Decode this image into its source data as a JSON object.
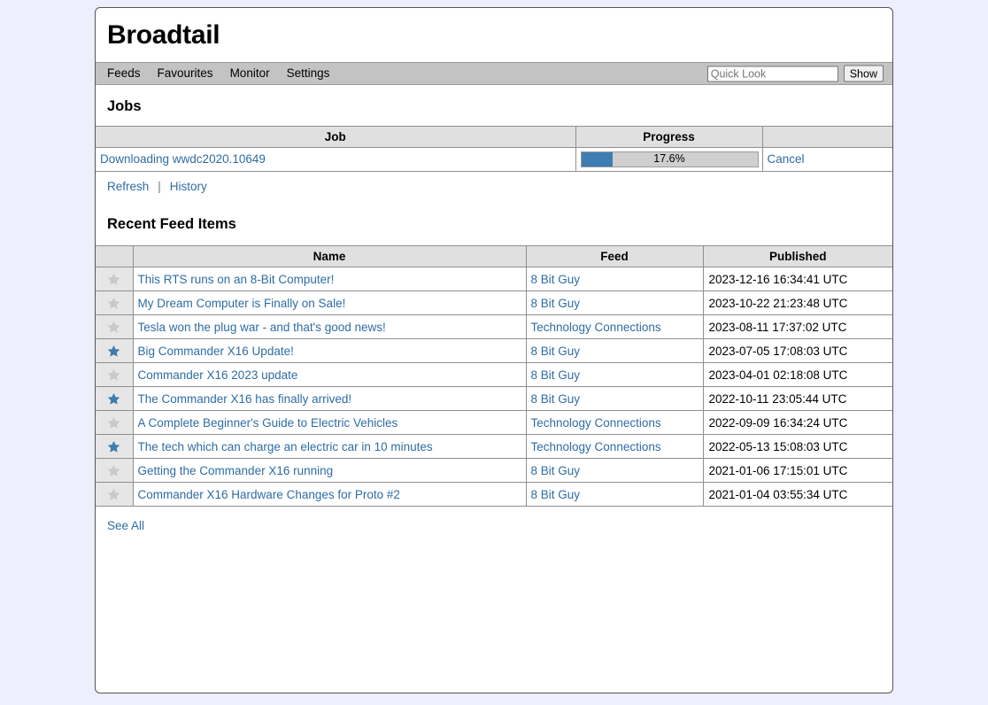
{
  "app": {
    "title": "Broadtail"
  },
  "nav": {
    "items": [
      {
        "label": "Feeds"
      },
      {
        "label": "Favourites"
      },
      {
        "label": "Monitor"
      },
      {
        "label": "Settings"
      }
    ],
    "quick_look": {
      "placeholder": "Quick Look",
      "value": "",
      "button_label": "Show"
    }
  },
  "jobs_section": {
    "heading": "Jobs",
    "columns": {
      "job": "Job",
      "progress": "Progress",
      "action": ""
    },
    "rows": [
      {
        "name": "Downloading wwdc2020.10649",
        "progress_percent": 17.6,
        "progress_label": "17.6%",
        "action_label": "Cancel"
      }
    ],
    "actions": {
      "refresh": "Refresh",
      "separator": "|",
      "history": "History"
    }
  },
  "feed_section": {
    "heading": "Recent Feed Items",
    "columns": {
      "star": "",
      "name": "Name",
      "feed": "Feed",
      "published": "Published"
    },
    "rows": [
      {
        "favourite": false,
        "star_icon": "star-outline-icon",
        "name": "This RTS runs on an 8-Bit Computer!",
        "feed": "8 Bit Guy",
        "published": "2023-12-16 16:34:41 UTC"
      },
      {
        "favourite": false,
        "star_icon": "star-outline-icon",
        "name": "My Dream Computer is Finally on Sale!",
        "feed": "8 Bit Guy",
        "published": "2023-10-22 21:23:48 UTC"
      },
      {
        "favourite": false,
        "star_icon": "star-outline-icon",
        "name": "Tesla won the plug war - and that's good news!",
        "feed": "Technology Connections",
        "published": "2023-08-11 17:37:02 UTC"
      },
      {
        "favourite": true,
        "star_icon": "star-filled-icon",
        "name": "Big Commander X16 Update!",
        "feed": "8 Bit Guy",
        "published": "2023-07-05 17:08:03 UTC"
      },
      {
        "favourite": false,
        "star_icon": "star-outline-icon",
        "name": "Commander X16 2023 update",
        "feed": "8 Bit Guy",
        "published": "2023-04-01 02:18:08 UTC"
      },
      {
        "favourite": true,
        "star_icon": "star-filled-icon",
        "name": "The Commander X16 has finally arrived!",
        "feed": "8 Bit Guy",
        "published": "2022-10-11 23:05:44 UTC"
      },
      {
        "favourite": false,
        "star_icon": "star-outline-icon",
        "name": "A Complete Beginner's Guide to Electric Vehicles",
        "feed": "Technology Connections",
        "published": "2022-09-09 16:34:24 UTC"
      },
      {
        "favourite": true,
        "star_icon": "star-filled-icon",
        "name": "The tech which can charge an electric car in 10 minutes",
        "feed": "Technology Connections",
        "published": "2022-05-13 15:08:03 UTC"
      },
      {
        "favourite": false,
        "star_icon": "star-outline-icon",
        "name": "Getting the Commander X16 running",
        "feed": "8 Bit Guy",
        "published": "2021-01-06 17:15:01 UTC"
      },
      {
        "favourite": false,
        "star_icon": "star-outline-icon",
        "name": "Commander X16 Hardware Changes for Proto #2",
        "feed": "8 Bit Guy",
        "published": "2021-01-04 03:55:34 UTC"
      }
    ],
    "see_all_label": "See All"
  },
  "colors": {
    "page_background": "#eeeeff",
    "nav_background": "#c3c3c3",
    "link": "#2e6da4",
    "progress_fill": "#3e7cb1",
    "star_filled": "#3e7cb1",
    "star_empty": "#c9c9c9",
    "table_header": "#e0e0e0"
  }
}
